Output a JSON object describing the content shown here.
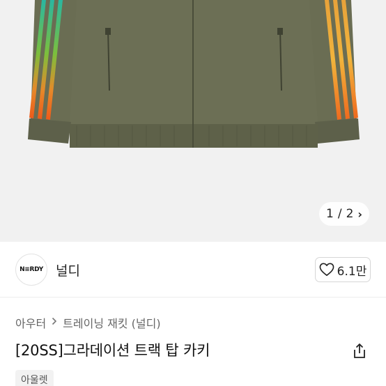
{
  "gallery": {
    "current": "1",
    "divider": "/",
    "total": "2",
    "next_glyph": "›"
  },
  "brand": {
    "logo_text": "N≡RDY",
    "name": "널디",
    "like_count": "6.1만"
  },
  "breadcrumb": {
    "items": [
      "아우터",
      "트레이닝 재킷 (널디)"
    ],
    "separator": ">"
  },
  "product": {
    "title": "[20SS]그라데이션 트랙 탑 카키",
    "tag": "아울렛"
  },
  "colors": {
    "jacket": "#6b6e54",
    "background": "#f1f1f1"
  }
}
